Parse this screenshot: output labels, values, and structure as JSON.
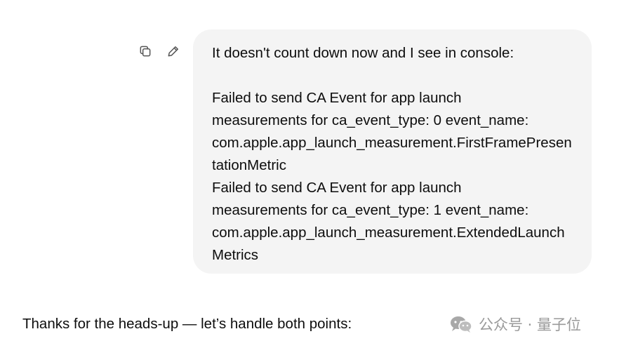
{
  "user_message": {
    "copy_icon": "copy-icon",
    "edit_icon": "pencil-icon",
    "text": "It doesn't count down now and I see in console:\n\nFailed to send CA Event for app launch\nmeasurements for ca_event_type: 0 event_name:\ncom.apple.app_launch_measurement.FirstFramePresentationMetric\nFailed to send CA Event for app launch\nmeasurements for ca_event_type: 1 event_name:\ncom.apple.app_launch_measurement.ExtendedLaunchMetrics"
  },
  "assistant_message": {
    "text": "Thanks for the heads-up — let’s handle both points:"
  },
  "watermark": {
    "icon": "wechat-icon",
    "text": "公众号 · 量子位"
  },
  "colors": {
    "bubble_background": "#f4f4f4",
    "text": "#0d0d0d",
    "icon": "#555555",
    "watermark": "#9a9a9a"
  }
}
